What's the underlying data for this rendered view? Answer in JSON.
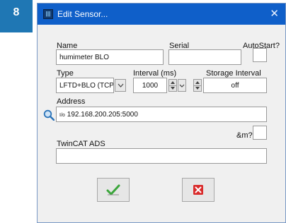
{
  "step_badge": "8",
  "window": {
    "title": "Edit Sensor...",
    "close_glyph": "✕",
    "app_icon_text": "|||"
  },
  "fields": {
    "name_label": "Name",
    "name_value": "humimeter BLO",
    "serial_label": "Serial",
    "serial_value": "",
    "autostart_label": "AutoStart?",
    "type_label": "Type",
    "type_value": "LFTD+BLO (TCP)",
    "interval_label": "Interval (ms)",
    "interval_value": "1000",
    "storage_label": "Storage Interval",
    "storage_value": "off",
    "address_label": "Address",
    "address_prefix": "I/o",
    "address_value": "192.168.200.205:5000",
    "m_label": "&m?",
    "twincat_label": "TwinCAT ADS",
    "twincat_value": ""
  },
  "icons": {
    "search": "search-icon",
    "ok": "checkmark-icon",
    "cancel": "cancel-x-icon",
    "close": "close-icon",
    "app": "app-icon"
  },
  "colors": {
    "titlebar": "#0f5fc9",
    "badge": "#1f77b4",
    "ok_green": "#3aa53a",
    "cancel_red": "#d92b2b"
  }
}
